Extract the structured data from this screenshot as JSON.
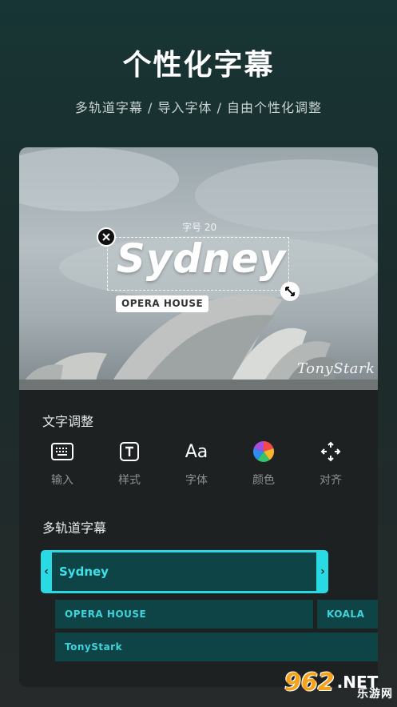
{
  "header": {
    "title": "个性化字幕",
    "subtitle": "多轨道字幕 / 导入字体 / 自由个性化调整"
  },
  "preview": {
    "size_label": "字号 20",
    "main_text": "Sydney",
    "sub_text": "OPERA HOUSE",
    "signature": "TonyStark",
    "close_icon": "close-icon",
    "resize_icon": "resize-icon"
  },
  "text_adjust": {
    "title": "文字调整",
    "tools": [
      {
        "label": "输入",
        "icon": "keyboard-icon"
      },
      {
        "label": "样式",
        "icon": "text-style-icon"
      },
      {
        "label": "字体",
        "icon": "font-icon",
        "glyph": "Aa"
      },
      {
        "label": "颜色",
        "icon": "color-wheel-icon"
      },
      {
        "label": "对齐",
        "icon": "align-move-icon"
      }
    ]
  },
  "tracks": {
    "title": "多轨道字幕",
    "main_clip": "Sydney",
    "clips": [
      "OPERA HOUSE",
      "KOALA",
      "TonyStark"
    ]
  },
  "watermark": {
    "number": "962",
    "suffix": ".NET",
    "text": "乐游网"
  },
  "colors": {
    "accent": "#29d9e3",
    "clip_bg": "#0f4446",
    "panel_bg": "#1e2121"
  }
}
